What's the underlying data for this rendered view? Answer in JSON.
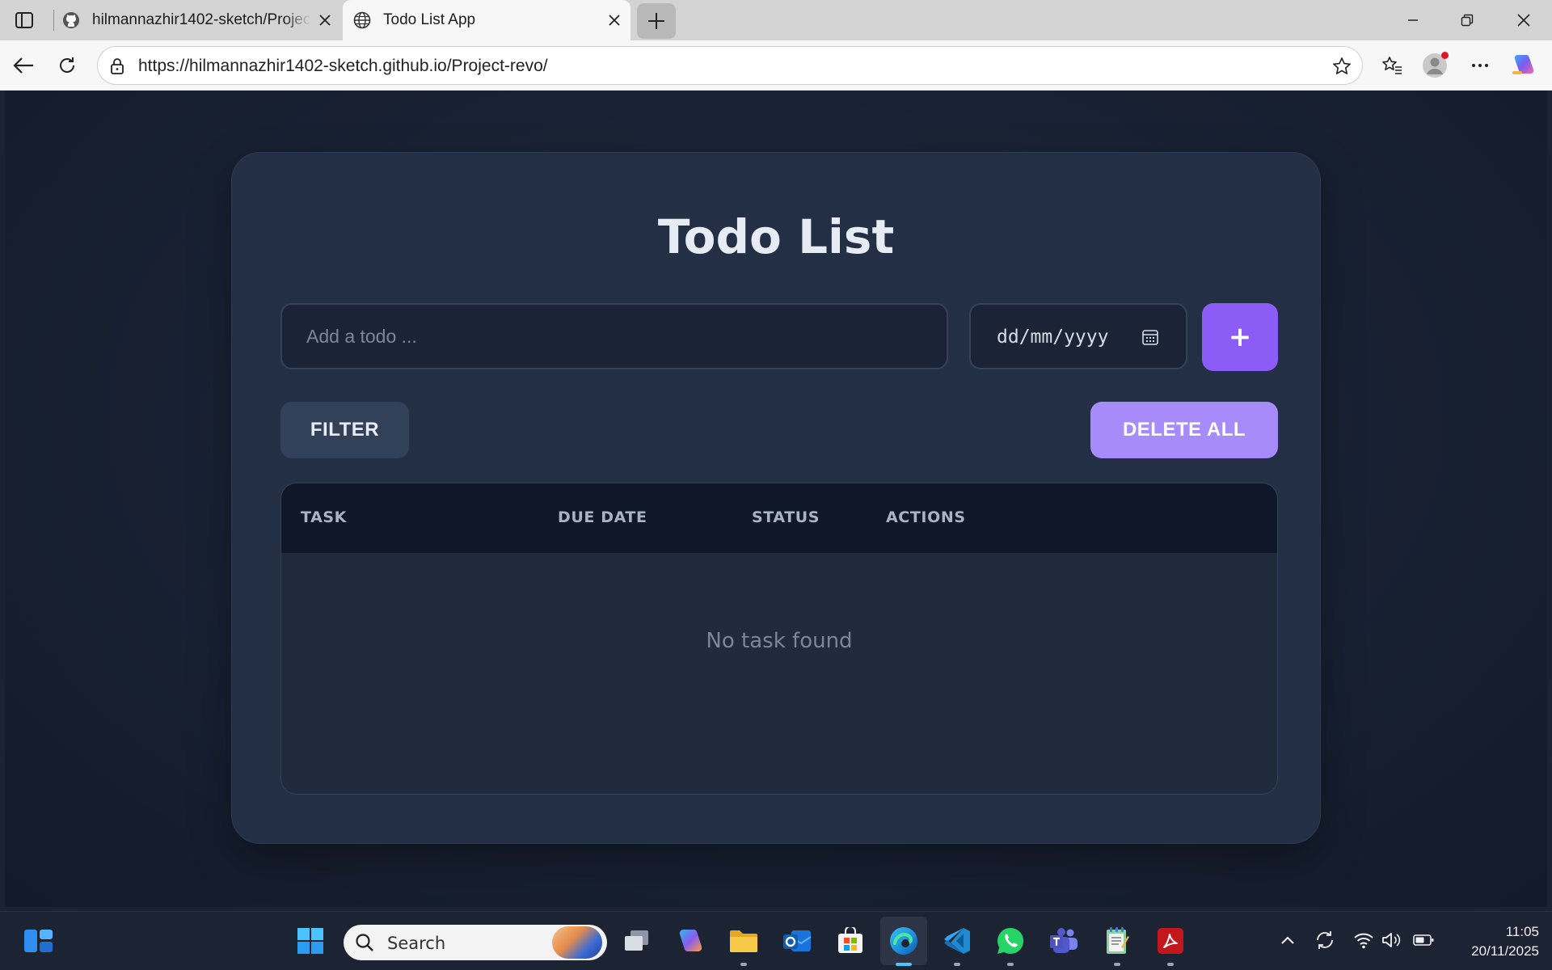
{
  "browser": {
    "tabs": [
      {
        "title": "hilmannazhir1402-sketch/Project-revo",
        "favicon": "github-icon",
        "active": false
      },
      {
        "title": "Todo List App",
        "favicon": "globe-icon",
        "active": true
      }
    ],
    "address_url": "https://hilmannazhir1402-sketch.github.io/Project-revo/"
  },
  "app": {
    "title": "Todo List",
    "todo_placeholder": "Add a todo ...",
    "date_placeholder": "dd/mm/yyyy",
    "add_label": "+",
    "filter_label": "FILTER",
    "delete_all_label": "DELETE ALL",
    "table": {
      "columns": [
        "TASK",
        "DUE DATE",
        "STATUS",
        "ACTIONS"
      ],
      "rows": [],
      "empty_message": "No task found"
    },
    "colors": {
      "accent": "#8b5cf6",
      "delete_all": "#a78bfa",
      "card": "#232f44",
      "table_header": "#0f1728"
    }
  },
  "taskbar": {
    "search_label": "Search",
    "apps": [
      "start-icon",
      "task-view-icon",
      "copilot-icon",
      "file-explorer-icon",
      "outlook-icon",
      "store-icon",
      "edge-icon",
      "vscode-icon",
      "whatsapp-icon",
      "teams-icon",
      "notepad-icon",
      "acrobat-icon"
    ],
    "time": "11:05",
    "date": "20/11/2025"
  }
}
